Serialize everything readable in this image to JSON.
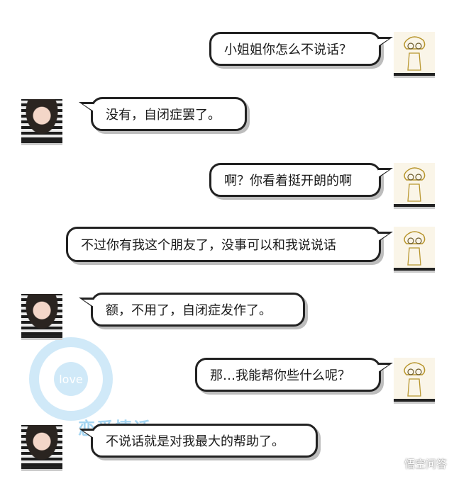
{
  "messages": [
    {
      "side": "right",
      "text": "小姐姐你怎么不说话？"
    },
    {
      "side": "left",
      "text": "没有，自闭症罢了。"
    },
    {
      "side": "right",
      "text": "啊？你看着挺开朗的啊"
    },
    {
      "side": "right",
      "text": "不过你有我这个朋友了，没事可以和我说说话"
    },
    {
      "side": "left",
      "text": "额，不用了，自闭症发作了。"
    },
    {
      "side": "right",
      "text": "那…我能帮你些什么呢？"
    },
    {
      "side": "left",
      "text": "不说话就是对我最大的帮助了。"
    }
  ],
  "watermark": {
    "text": "恋爱情话",
    "logo_text": "love"
  },
  "brand": {
    "label": "悟空问答",
    "icon": "wukong-qa-icon"
  }
}
